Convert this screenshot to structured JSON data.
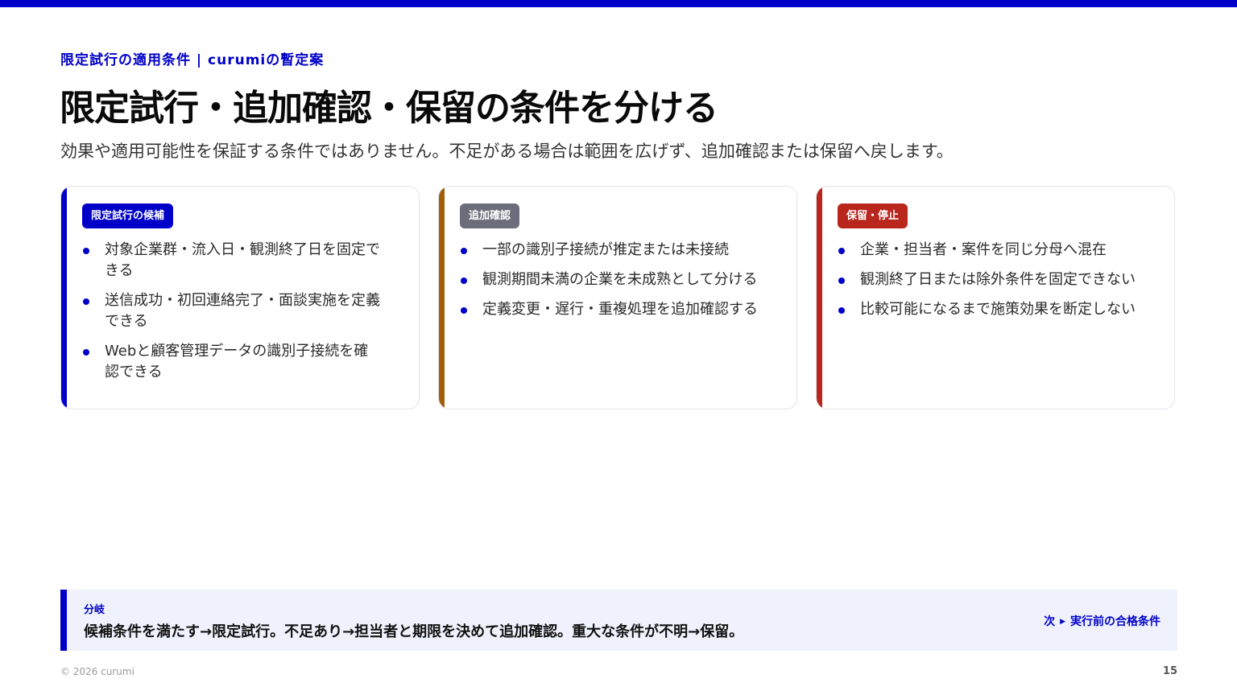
{
  "header": {
    "eyebrow": "限定試行の適用条件 | curumiの暫定案",
    "title": "限定試行・追加確認・保留の条件を分ける",
    "subtitle": "効果や適用可能性を保証する条件ではありません。不足がある場合は範囲を広げず、追加確認または保留へ戻します。"
  },
  "cards": [
    {
      "badge": "限定試行の候補",
      "accent_color": "#0000c8",
      "items": [
        "対象企業群・流入日・観測終了日を固定できる",
        "送信成功・初回連絡完了・面談実施を定義できる",
        "Webと顧客管理データの識別子接続を確認できる"
      ]
    },
    {
      "badge": "追加確認",
      "accent_color": "#a35e0b",
      "items": [
        "一部の識別子接続が推定または未接続",
        "観測期間未満の企業を未成熟として分ける",
        "定義変更・遅行・重複処理を追加確認する"
      ]
    },
    {
      "badge": "保留・停止",
      "accent_color": "#b8261c",
      "items": [
        "企業・担当者・案件を同じ分母へ混在",
        "観測終了日または除外条件を固定できない",
        "比較可能になるまで施策効果を断定しない"
      ]
    }
  ],
  "footer": {
    "label": "分岐",
    "text": "候補条件を満たす→限定試行。不足あり→担当者と期限を決めて追加確認。重大な条件が不明→保留。",
    "next_prefix": "次",
    "next_label": "実行前の合格条件"
  },
  "copyright": "© 2026 curumi",
  "page_number": "15"
}
